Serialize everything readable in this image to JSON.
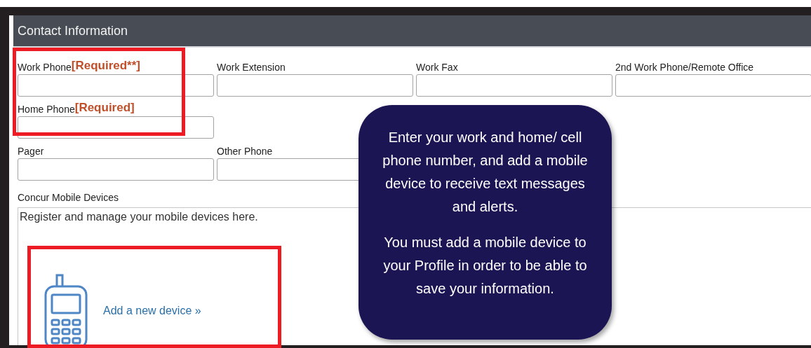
{
  "header": {
    "title": "Contact Information"
  },
  "field_rows": [
    [
      {
        "label": "Work Phone",
        "required_tag": "[Required**]"
      },
      {
        "label": "Work Extension"
      },
      {
        "label": "Work Fax"
      },
      {
        "label": "2nd Work Phone/Remote Office"
      }
    ],
    [
      {
        "label": "Home Phone",
        "required_tag": "[Required]"
      }
    ],
    [
      {
        "label": "Pager"
      },
      {
        "label": "Other Phone"
      }
    ]
  ],
  "mobile_devices": {
    "label": "Concur Mobile Devices",
    "description": "Register and manage your mobile devices here.",
    "link": "Add a new device »"
  },
  "callout": {
    "paragraphs": [
      "Enter your work and home/ cell phone number, and add a mobile device to receive text messages and alerts.",
      "You must add a mobile device to your Profile in order to be able to save your information."
    ]
  }
}
